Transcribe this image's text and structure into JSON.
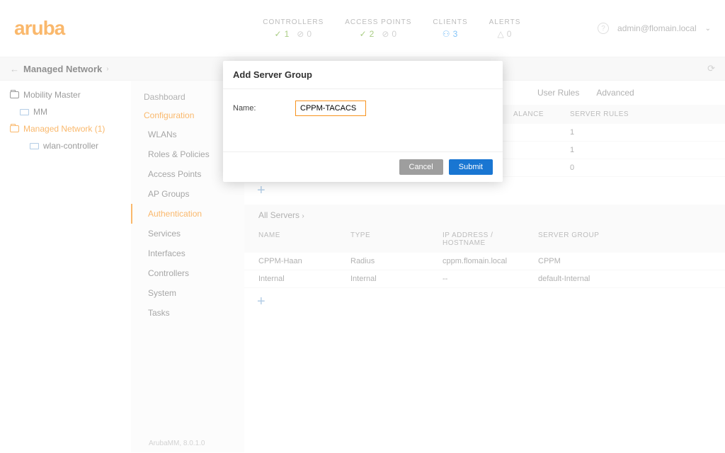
{
  "header": {
    "logo": "aruba",
    "stats": {
      "controllers": {
        "label": "CONTROLLERS",
        "ok": "1",
        "warn": "0"
      },
      "access_points": {
        "label": "ACCESS POINTS",
        "ok": "2",
        "warn": "0"
      },
      "clients": {
        "label": "CLIENTS",
        "count": "3"
      },
      "alerts": {
        "label": "ALERTS",
        "count": "0"
      }
    },
    "user": "admin@flomain.local"
  },
  "breadcrumb": {
    "label": "Managed Network"
  },
  "tree": {
    "root": "Mobility Master",
    "mm": "MM",
    "managed": "Managed Network (1)",
    "wlan": "wlan-controller"
  },
  "nav": {
    "dashboard": "Dashboard",
    "configuration": "Configuration",
    "items": [
      "WLANs",
      "Roles & Policies",
      "Access Points",
      "AP Groups",
      "Authentication",
      "Services",
      "Interfaces",
      "Controllers",
      "System",
      "Tasks"
    ]
  },
  "tabs": {
    "user_rules": "User Rules",
    "advanced": "Advanced"
  },
  "server_groups": {
    "headers": {
      "balance": "ALANCE",
      "rules": "SERVER RULES"
    },
    "rows": [
      "1",
      "1",
      "0"
    ]
  },
  "all_servers": {
    "title": "All Servers",
    "headers": {
      "name": "NAME",
      "type": "TYPE",
      "ip": "IP ADDRESS / HOSTNAME",
      "group": "SERVER GROUP"
    },
    "rows": [
      {
        "name": "CPPM-Haan",
        "type": "Radius",
        "ip": "cppm.flomain.local",
        "group": "CPPM"
      },
      {
        "name": "Internal",
        "type": "Internal",
        "ip": "--",
        "group": "default-Internal"
      }
    ]
  },
  "dialog": {
    "title": "Add Server Group",
    "name_label": "Name:",
    "name_value": "CPPM-TACACS",
    "cancel": "Cancel",
    "submit": "Submit"
  },
  "footer": "ArubaMM, 8.0.1.0"
}
